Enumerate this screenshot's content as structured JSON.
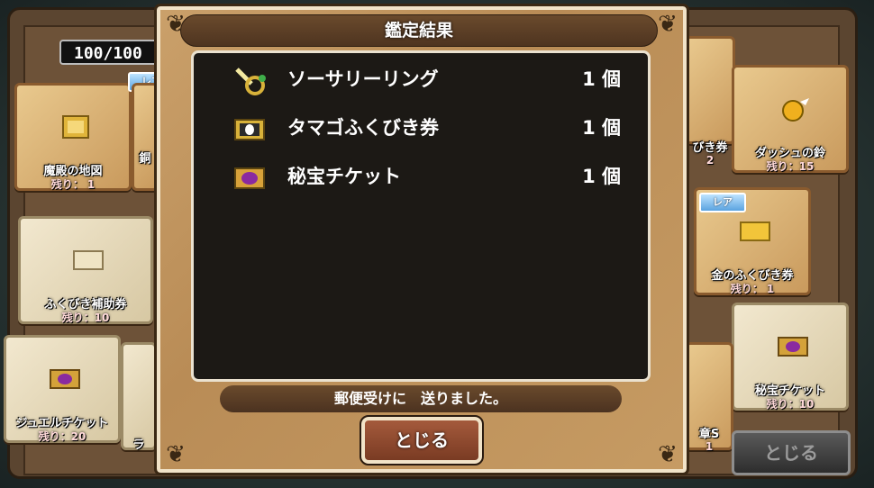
{
  "counter": "100/100",
  "background_cards": [
    {
      "name": "魔殿の地図",
      "qty": "残り： 1",
      "variant": "tan",
      "icon": "map-icon"
    },
    {
      "name": "ふくびき補助券",
      "qty": "残り：10",
      "variant": "pale",
      "icon": "ticket-icon"
    },
    {
      "name": "ジュエルチケット",
      "qty": "残り：20",
      "variant": "pale",
      "icon": "jewel-ticket-icon"
    },
    {
      "name": "ダッシュの鈴",
      "qty": "残り：15",
      "variant": "tan",
      "icon": "bell-icon"
    },
    {
      "name": "金のふくびき券",
      "qty": "残り： 1",
      "variant": "tan",
      "icon": "gold-ticket-icon"
    },
    {
      "name": "秘宝チケット",
      "qty": "残り：10",
      "variant": "pale",
      "icon": "treasure-ticket-icon"
    }
  ],
  "partial_labels": {
    "left_cut_1": "銅",
    "left_cut_2": "ラ",
    "right_cut_1": "びき券",
    "right_cut_2": "2",
    "right_cut_3": "章S",
    "right_cut_4": "1"
  },
  "rare_badge": "レア",
  "background_close": "とじる",
  "dialog": {
    "title": "鑑定結果",
    "items": [
      {
        "name": "ソーサリーリング",
        "count": "1 個",
        "icon": "ring-icon"
      },
      {
        "name": "タマゴふくびき券",
        "count": "1 個",
        "icon": "egg-ticket-icon"
      },
      {
        "name": "秘宝チケット",
        "count": "1 個",
        "icon": "treasure-ticket-icon"
      }
    ],
    "message": "郵便受けに　送りました。",
    "close_label": "とじる"
  },
  "colors": {
    "dialog_bg": "#c69b63",
    "list_bg": "#1c1915",
    "close_btn": "#8e4a2f"
  }
}
